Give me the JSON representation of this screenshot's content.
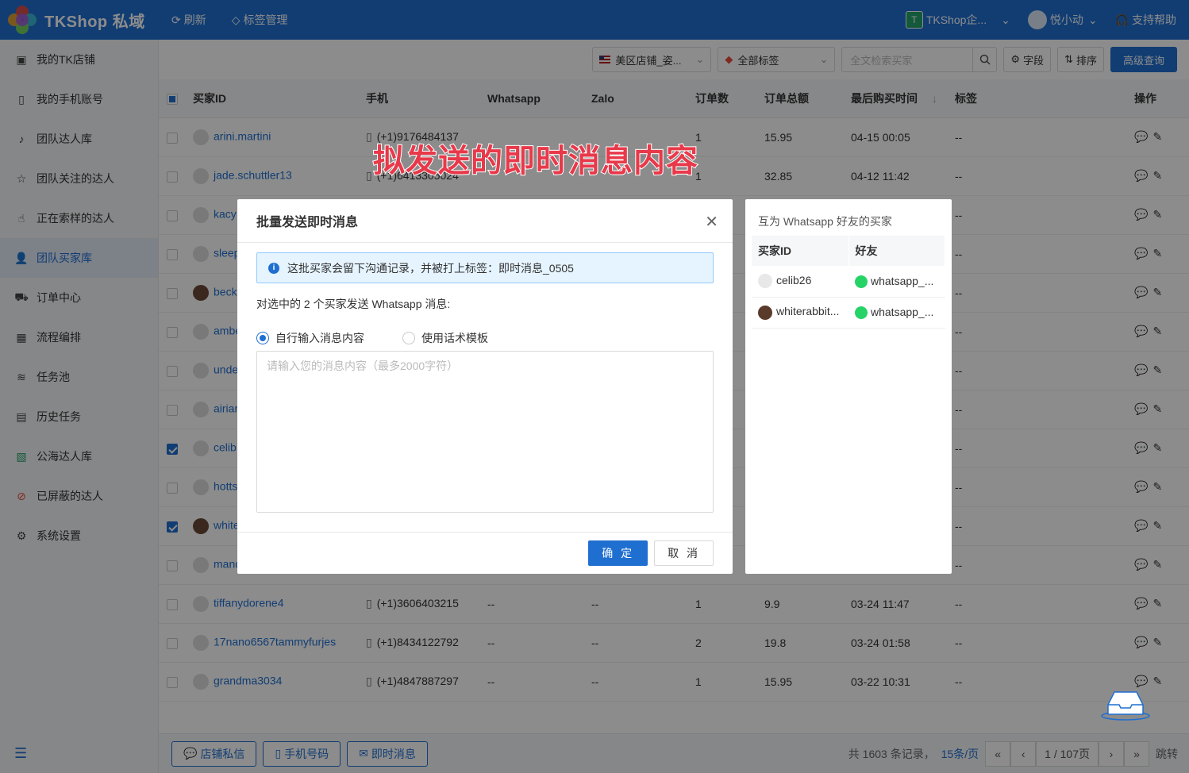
{
  "app": {
    "title": "TKShop 私域"
  },
  "topbar": {
    "refresh": "刷新",
    "tag_manage": "标签管理",
    "team": "TKShop企...",
    "team_badge": "T",
    "user": "悦小动",
    "help": "支持帮助"
  },
  "sidebar": {
    "items": [
      {
        "label": "我的TK店铺",
        "icon": "shop-icon"
      },
      {
        "label": "我的手机账号",
        "icon": "phone-icon"
      },
      {
        "label": "团队达人库",
        "icon": "tiktok-icon"
      },
      {
        "label": "团队关注的达人",
        "icon": "star-icon"
      },
      {
        "label": "正在索样的达人",
        "icon": "hand-icon"
      },
      {
        "label": "团队买家库",
        "icon": "user-icon"
      },
      {
        "label": "订单中心",
        "icon": "truck-icon"
      },
      {
        "label": "流程编排",
        "icon": "calendar-icon"
      },
      {
        "label": "任务池",
        "icon": "layers-icon"
      },
      {
        "label": "历史任务",
        "icon": "clipboard-icon"
      },
      {
        "label": "公海达人库",
        "icon": "tiktok-square-icon"
      },
      {
        "label": "已屏蔽的达人",
        "icon": "ban-icon"
      },
      {
        "label": "系统设置",
        "icon": "gear-icon"
      }
    ]
  },
  "toolbar": {
    "shop_select": "美区店铺_姿...",
    "tag_select": "全部标签",
    "search_placeholder": "全文检索买家",
    "fields": "字段",
    "sort": "排序",
    "advanced": "高级查询"
  },
  "table": {
    "columns": [
      "买家ID",
      "手机",
      "Whatsapp",
      "Zalo",
      "订单数",
      "订单总额",
      "最后购买时间",
      "标签",
      "操作"
    ],
    "rows": [
      {
        "id": "arini.martini",
        "phone": "(+1)9176484137",
        "whatsapp": "",
        "zalo": "",
        "orders": "1",
        "amount": "15.95",
        "last": "04-15 00:05",
        "tag": "--",
        "checked": false
      },
      {
        "id": "jade.schuttler13",
        "phone": "(+1)6413305024",
        "whatsapp": "",
        "zalo": "",
        "orders": "1",
        "amount": "32.85",
        "last": "04-12 11:42",
        "tag": "--",
        "checked": false
      },
      {
        "id": "kacy",
        "phone": "",
        "whatsapp": "",
        "zalo": "",
        "orders": "",
        "amount": "",
        "last": "",
        "tag": "--",
        "checked": false
      },
      {
        "id": "sleep",
        "phone": "",
        "whatsapp": "",
        "zalo": "",
        "orders": "",
        "amount": "",
        "last": "",
        "tag": "--",
        "checked": false
      },
      {
        "id": "beck",
        "phone": "",
        "whatsapp": "",
        "zalo": "",
        "orders": "",
        "amount": "",
        "last": "",
        "tag": "--",
        "checked": false
      },
      {
        "id": "ambe",
        "phone": "",
        "whatsapp": "",
        "zalo": "",
        "orders": "",
        "amount": "",
        "last": "",
        "tag": "--",
        "checked": false
      },
      {
        "id": "unde",
        "phone": "",
        "whatsapp": "",
        "zalo": "",
        "orders": "",
        "amount": "",
        "last": "",
        "tag": "--",
        "checked": false
      },
      {
        "id": "airiar",
        "phone": "",
        "whatsapp": "",
        "zalo": "",
        "orders": "",
        "amount": "",
        "last": "",
        "tag": "--",
        "checked": false
      },
      {
        "id": "celib",
        "phone": "",
        "whatsapp": "",
        "zalo": "",
        "orders": "",
        "amount": "",
        "last": "",
        "tag": "--",
        "checked": true
      },
      {
        "id": "hotts",
        "phone": "",
        "whatsapp": "",
        "zalo": "",
        "orders": "",
        "amount": "",
        "last": "",
        "tag": "--",
        "checked": false
      },
      {
        "id": "white",
        "phone": "",
        "whatsapp": "",
        "zalo": "",
        "orders": "",
        "amount": "",
        "last": "",
        "tag": "--",
        "checked": true
      },
      {
        "id": "mand",
        "phone": "",
        "whatsapp": "",
        "zalo": "",
        "orders": "",
        "amount": "",
        "last": "",
        "tag": "--",
        "checked": false
      },
      {
        "id": "tiffanydorene4",
        "phone": "(+1)3606403215",
        "whatsapp": "--",
        "zalo": "--",
        "orders": "1",
        "amount": "9.9",
        "last": "03-24 11:47",
        "tag": "--",
        "checked": false
      },
      {
        "id": "17nano6567tammyfurjes",
        "phone": "(+1)8434122792",
        "whatsapp": "--",
        "zalo": "--",
        "orders": "2",
        "amount": "19.8",
        "last": "03-24 01:58",
        "tag": "--",
        "checked": false
      },
      {
        "id": "grandma3034",
        "phone": "(+1)4847887297",
        "whatsapp": "--",
        "zalo": "--",
        "orders": "1",
        "amount": "15.95",
        "last": "03-22 10:31",
        "tag": "--",
        "checked": false
      }
    ]
  },
  "footer": {
    "shop_msg": "店铺私信",
    "phone_num": "手机号码",
    "instant_msg": "即时消息",
    "total": "共 1603 条记录，",
    "page_size": "15条/页",
    "page": "1 / 107页",
    "jump": "跳转"
  },
  "modal": {
    "title": "批量发送即时消息",
    "alert": "这批买家会留下沟通记录，并被打上标签：即时消息_0505",
    "desc": "对选中的 2 个买家发送 Whatsapp 消息:",
    "radio_custom": "自行输入消息内容",
    "radio_template": "使用话术模板",
    "textarea_placeholder": "请输入您的消息内容（最多2000字符）",
    "ok": "确 定",
    "cancel": "取 消"
  },
  "side_panel": {
    "title": "互为 Whatsapp 好友的买家",
    "col_id": "买家ID",
    "col_friend": "好友",
    "rows": [
      {
        "id": "celib26",
        "friend": "whatsapp_..."
      },
      {
        "id": "whiterabbit...",
        "friend": "whatsapp_..."
      }
    ]
  },
  "caption": "拟发送的即时消息内容",
  "colors": {
    "primary": "#1f6fd1",
    "whatsapp": "#25d366",
    "caption": "#e8394a"
  }
}
